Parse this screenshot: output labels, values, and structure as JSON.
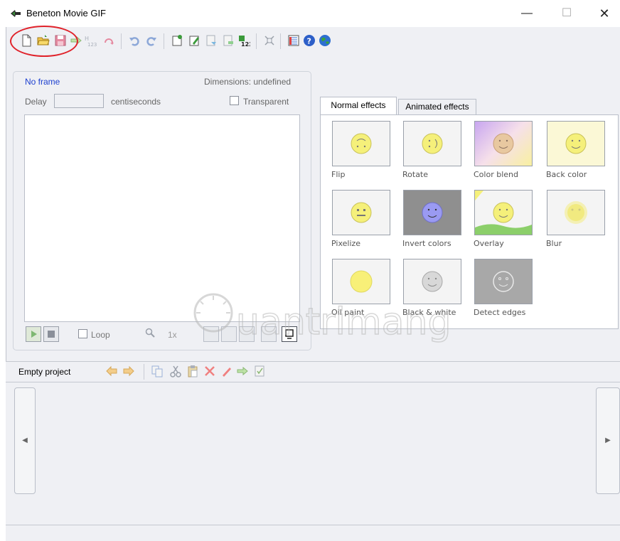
{
  "window": {
    "title": "Beneton Movie GIF",
    "minimize": "—",
    "maximize": "☐",
    "close": "✕"
  },
  "toolbar": {
    "items": [
      "new-file-icon",
      "open-folder-icon",
      "save-icon",
      "export-icon",
      "numbered-frames-icon",
      "reverse-icon",
      "undo-icon",
      "redo-icon",
      "new-frame-icon",
      "edit-frame-icon",
      "import-frame-icon",
      "export-frame-icon",
      "renumber-icon",
      "resize-icon",
      "properties-icon",
      "help-icon",
      "web-icon"
    ]
  },
  "frame": {
    "status": "No frame",
    "dimensions": "Dimensions: undefined",
    "delay_label": "Delay",
    "delay_value": "",
    "delay_unit": "centiseconds",
    "transparent_label": "Transparent",
    "loop_label": "Loop",
    "zoom_label": "1x"
  },
  "effects": {
    "tabs": [
      "Normal effects",
      "Animated effects"
    ],
    "items": [
      "Flip",
      "Rotate",
      "Color blend",
      "Back color",
      "Pixelize",
      "Invert colors",
      "Overlay",
      "Blur",
      "Oil paint",
      "Black & white",
      "Detect edges"
    ]
  },
  "project": {
    "label": "Empty project"
  },
  "strip": {
    "left_arrow": "◀",
    "right_arrow": "▶"
  },
  "watermark": {
    "text": "uantrimang"
  },
  "colors": {
    "accent": "#1c3fcf",
    "highlight": "#e0222a",
    "panel_bg": "#eff0f4",
    "smiley": "#f5f07a"
  }
}
